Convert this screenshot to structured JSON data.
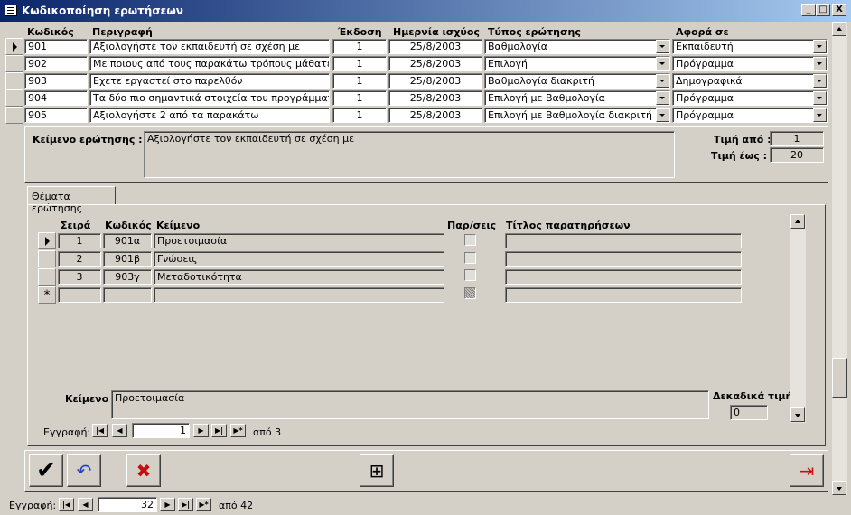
{
  "window": {
    "title": "Κωδικοποίηση ερωτήσεων",
    "controls": {
      "minimize": "_",
      "restore": "□",
      "close": "X"
    }
  },
  "grid": {
    "headers": [
      "Κωδικός",
      "Περιγραφή",
      "Έκδοση",
      "Ημερνία ισχύος",
      "Τύπος ερώτησης",
      "Αφορά σε"
    ],
    "rows": [
      [
        "901",
        "Αξιολογήστε τον εκπαιδευτή σε σχέση με",
        "1",
        "25/8/2003",
        "Βαθμολογία",
        "Εκπαιδευτή"
      ],
      [
        "902",
        "Με ποιους από τους παρακάτω τρόπους μάθατε για",
        "1",
        "25/8/2003",
        "Επιλογή",
        "Πρόγραμμα"
      ],
      [
        "903",
        "Εχετε εργαστεί στο παρελθόν",
        "1",
        "25/8/2003",
        "Βαθμολογία διακριτή",
        "Δημογραφικά"
      ],
      [
        "904",
        "Τα δύο πιο σημαντικά στοιχεία του προγράμματος",
        "1",
        "25/8/2003",
        "Επιλογή με Βαθμολογία",
        "Πρόγραμμα"
      ],
      [
        "905",
        "Αξιολογήστε 2 από τα παρακάτω",
        "1",
        "25/8/2003",
        "Επιλογή με Βαθμολογία διακριτή",
        "Πρόγραμμα"
      ]
    ]
  },
  "question": {
    "text_label": "Κείμενο ερώτησης :",
    "text_value": "Αξιολογήστε τον εκπαιδευτή σε σχέση με",
    "value_from_label": "Τιμή από :",
    "value_from": "1",
    "value_to_label": "Τιμή έως :",
    "value_to": "20"
  },
  "tab": {
    "label": "Θέματα ερώτησης"
  },
  "subgrid": {
    "headers": [
      "Σειρά",
      "Κωδικός",
      "Κείμενο",
      "Παρ/σεις",
      "Τίτλος παρατηρήσεων"
    ],
    "rows": [
      [
        "1",
        "901α",
        "Προετοιμασία"
      ],
      [
        "2",
        "901β",
        "Γνώσεις"
      ],
      [
        "3",
        "903γ",
        "Μεταδοτικότητα"
      ]
    ],
    "new_row_marker": "*",
    "text_label": "Κείμενο :",
    "text_value": "Προετοιμασία",
    "decimals_label": "Δεκαδικά τιμής",
    "decimals_value": "0",
    "nav": {
      "label": "Εγγραφή:",
      "current": "1",
      "total": "από 3"
    }
  },
  "main_nav": {
    "label": "Εγγραφή:",
    "current": "32",
    "total": "από 42"
  },
  "nav_glyphs": {
    "first": "|◀",
    "prev": "◀",
    "next": "▶",
    "last": "▶|",
    "new": "▶*"
  },
  "buttons": {
    "ok": "✔",
    "undo": "↶",
    "delete": "✖",
    "structure": "⊞",
    "exit": "⇥"
  },
  "colors": {
    "face": "#d4d0c8",
    "title_start": "#0a246a",
    "title_end": "#a6caf0"
  }
}
